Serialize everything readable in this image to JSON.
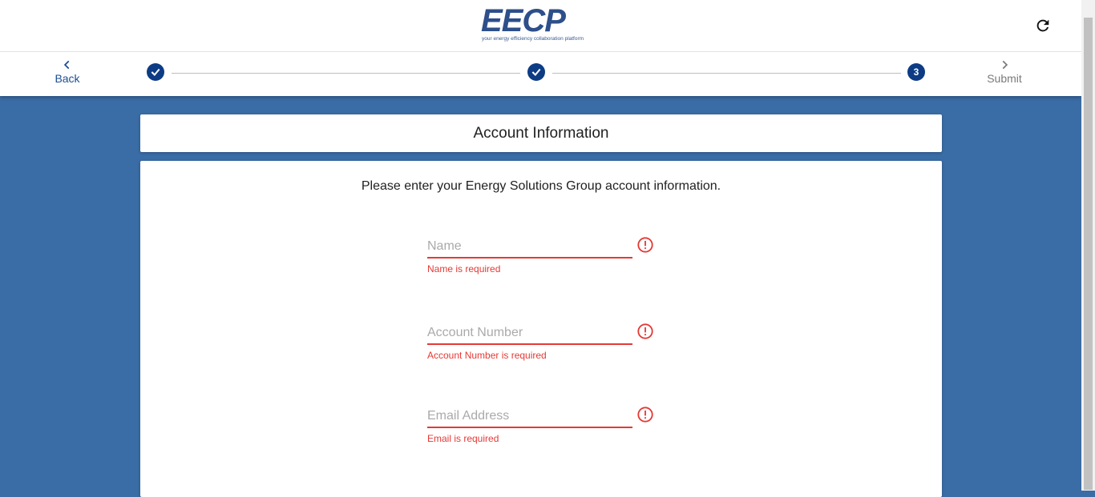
{
  "header": {
    "logo_text": "EECP",
    "logo_tagline": "your energy efficiency collaboration platform"
  },
  "stepper": {
    "back_label": "Back",
    "submit_label": "Submit",
    "steps": [
      {
        "state": "completed",
        "icon": "check-icon"
      },
      {
        "state": "completed",
        "icon": "check-icon"
      },
      {
        "state": "current",
        "label": "3"
      }
    ]
  },
  "form": {
    "title": "Account Information",
    "instructions": "Please enter your Energy Solutions Group account information.",
    "fields": [
      {
        "placeholder": "Name",
        "value": "",
        "error": "Name is required"
      },
      {
        "placeholder": "Account Number",
        "value": "",
        "error": "Account Number is required"
      },
      {
        "placeholder": "Email Address",
        "value": "",
        "error": "Email is required"
      }
    ]
  },
  "colors": {
    "background": "#3a6ca5",
    "accent": "#0d3c85",
    "error": "#e53935"
  }
}
